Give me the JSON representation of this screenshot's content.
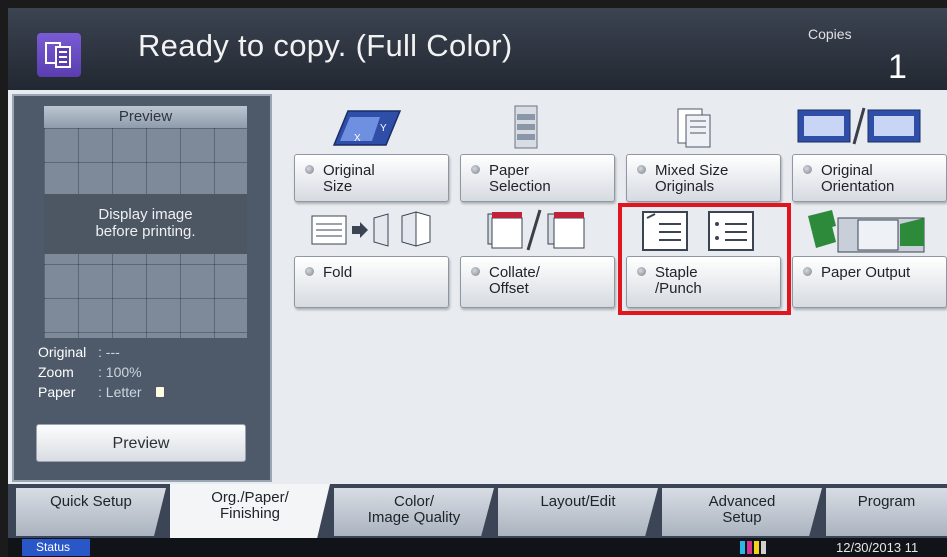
{
  "header": {
    "title": "Ready to copy. (Full Color)",
    "copies_label": "Copies",
    "copies_value": "1",
    "icon": "copy-icon"
  },
  "preview_panel": {
    "heading": "Preview",
    "message_line1": "Display image",
    "message_line2": "before printing.",
    "info": [
      {
        "key": "Original",
        "value": ": ---"
      },
      {
        "key": "Zoom",
        "value": ": 100%"
      },
      {
        "key": "Paper",
        "value": ": Letter"
      }
    ],
    "button_label": "Preview"
  },
  "functions": [
    {
      "line1": "Original",
      "line2": "Size",
      "icon": "original-size-icon"
    },
    {
      "line1": "Paper",
      "line2": "Selection",
      "icon": "paper-selection-icon"
    },
    {
      "line1": "Mixed Size",
      "line2": "Originals",
      "icon": "mixed-size-icon"
    },
    {
      "line1": "Original",
      "line2": "Orientation",
      "icon": "original-orientation-icon"
    },
    {
      "line1": "Fold",
      "line2": "",
      "icon": "fold-icon"
    },
    {
      "line1": "Collate/",
      "line2": "Offset",
      "icon": "collate-offset-icon"
    },
    {
      "line1": "Staple",
      "line2": "/Punch",
      "icon": "staple-punch-icon"
    },
    {
      "line1": "Paper Output",
      "line2": "",
      "icon": "paper-output-icon"
    }
  ],
  "highlighted_function": "Staple /Punch",
  "tabs": [
    {
      "line1": "Quick Setup",
      "line2": ""
    },
    {
      "line1": "Org./Paper/",
      "line2": "Finishing"
    },
    {
      "line1": "Color/",
      "line2": "Image Quality"
    },
    {
      "line1": "Layout/Edit",
      "line2": ""
    },
    {
      "line1": "Advanced",
      "line2": "Setup"
    },
    {
      "line1": "Program",
      "line2": ""
    }
  ],
  "active_tab": "Org./Paper/ Finishing",
  "status_bar": {
    "status_label": "Status",
    "datetime": "12/30/2013 11"
  },
  "colors": {
    "accent_purple": "#6a4cc4",
    "highlight_red": "#e0151d",
    "status_blue": "#2a57c8",
    "toner": [
      "#29b6e8",
      "#d6338f",
      "#f2d21a",
      "#222222"
    ]
  }
}
